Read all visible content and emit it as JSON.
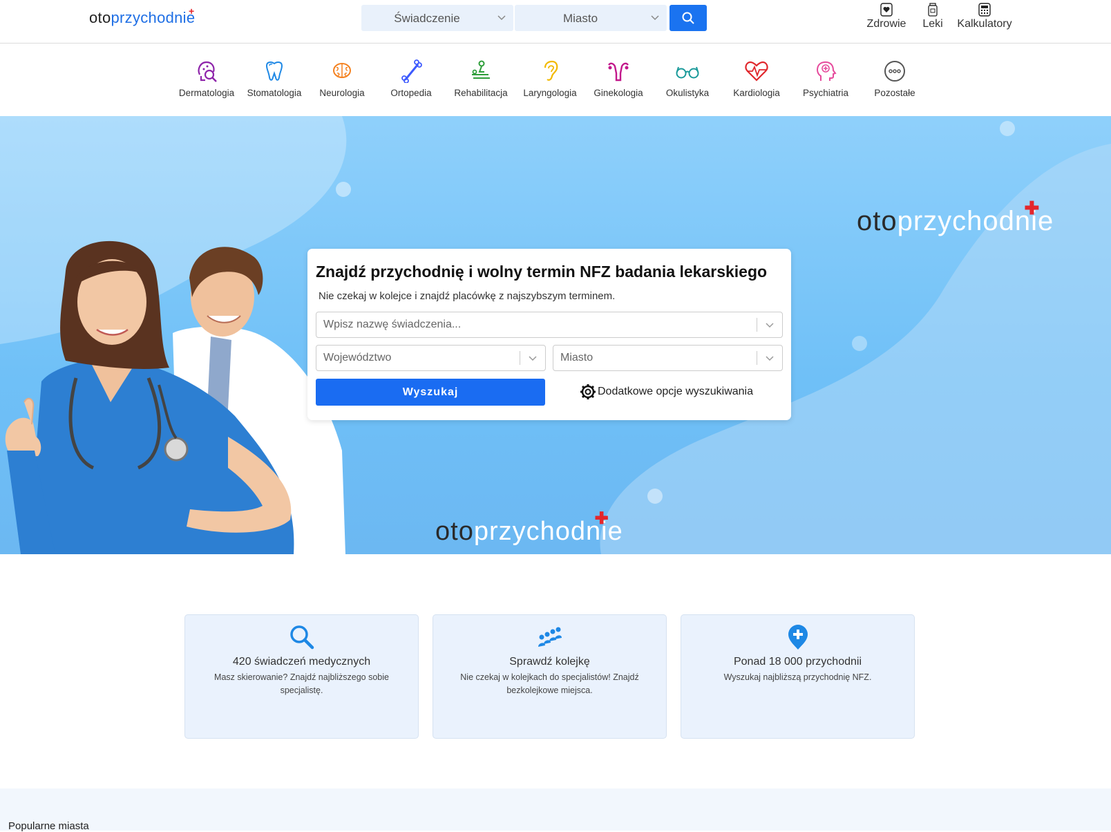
{
  "header": {
    "logo": {
      "part1": "oto",
      "part2": "przychodnie",
      "cross": "+"
    },
    "service_select": "Świadczenie",
    "city_select": "Miasto",
    "nav": [
      {
        "label": "Zdrowie",
        "icon": "heart-icon"
      },
      {
        "label": "Leki",
        "icon": "medicine-bottle-icon"
      },
      {
        "label": "Kalkulatory",
        "icon": "calculator-icon"
      }
    ]
  },
  "categories": [
    {
      "label": "Dermatologia",
      "icon": "dermatology-icon",
      "color": "#8e24aa"
    },
    {
      "label": "Stomatologia",
      "icon": "tooth-icon",
      "color": "#1e88e5"
    },
    {
      "label": "Neurologia",
      "icon": "brain-icon",
      "color": "#f4811f"
    },
    {
      "label": "Ortopedia",
      "icon": "bone-icon",
      "color": "#3d5afe"
    },
    {
      "label": "Rehabilitacja",
      "icon": "massage-icon",
      "color": "#2e9e3a"
    },
    {
      "label": "Laryngologia",
      "icon": "ear-icon",
      "color": "#f2b900"
    },
    {
      "label": "Ginekologia",
      "icon": "uterus-icon",
      "color": "#c2188b"
    },
    {
      "label": "Okulistyka",
      "icon": "glasses-icon",
      "color": "#1a9a9a"
    },
    {
      "label": "Kardiologia",
      "icon": "heart-pulse-icon",
      "color": "#e0262b"
    },
    {
      "label": "Psychiatria",
      "icon": "head-plus-icon",
      "color": "#e64a9c"
    },
    {
      "label": "Pozostałe",
      "icon": "more-dots-icon",
      "color": "#555555"
    }
  ],
  "hero": {
    "logo": {
      "part1": "oto",
      "part2": "przychodnie"
    },
    "title": "Znajdź przychodnię i wolny termin NFZ badania lekarskiego",
    "subtitle": "Nie czekaj w kolejce i znajdź placówkę z najszybszym terminem.",
    "service_placeholder": "Wpisz nazwę świadczenia...",
    "region_placeholder": "Województwo",
    "city_placeholder": "Miasto",
    "search_button": "Wyszukaj",
    "more_options": "Dodatkowe opcje wyszukiwania"
  },
  "info_cards": [
    {
      "title": "420 świadczeń medycznych",
      "desc": "Masz skierowanie? Znajdź najbliższego sobie specjalistę.",
      "icon": "search-icon"
    },
    {
      "title": "Sprawdź kolejkę",
      "desc": "Nie czekaj w kolejkach do specjalistów! Znajdź bezkolejkowe miejsca.",
      "icon": "queue-icon"
    },
    {
      "title": "Ponad 18 000 przychodnii",
      "desc": "Wyszukaj najbliższą przychodnię NFZ.",
      "icon": "location-plus-icon"
    }
  ],
  "popular": {
    "title": "Popularne miasta"
  },
  "colors": {
    "accent": "#1a6cf2",
    "cross": "#e4262b",
    "hero_bg": "#75c3f7"
  }
}
